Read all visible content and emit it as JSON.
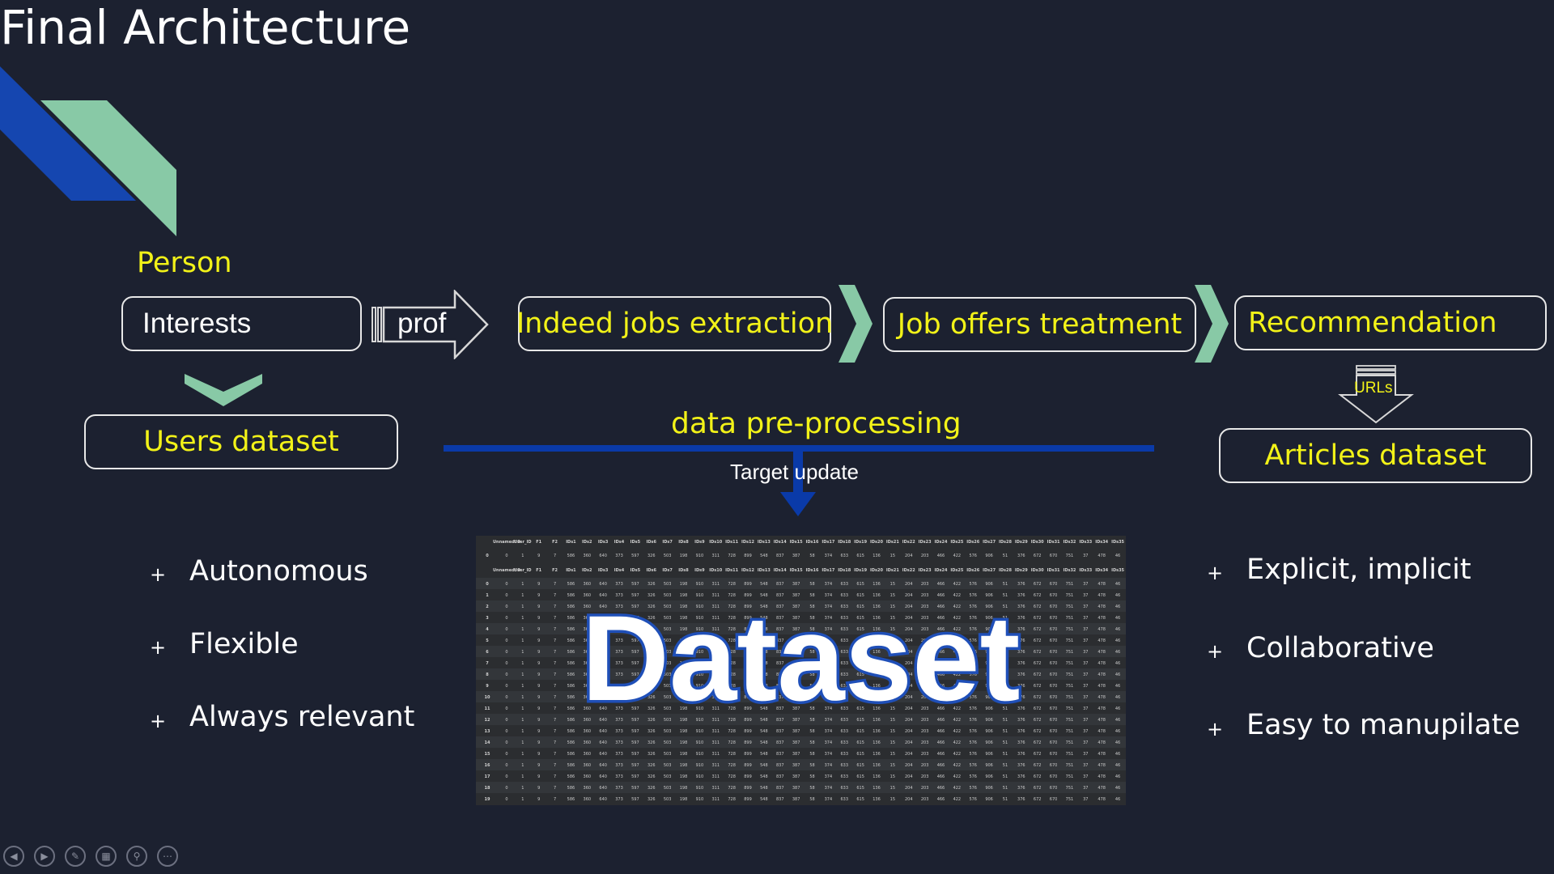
{
  "slide": {
    "title": "Final Architecture"
  },
  "flow": {
    "person_label": "Person",
    "interests": "Interests",
    "prof_arrow": "prof",
    "indeed": "Indeed jobs extraction",
    "treatment": "Job offers treatment",
    "recommendation": "Recommendation",
    "urls_arrow": "URLs",
    "users_dataset": "Users dataset",
    "preprocessing": "data pre-processing",
    "target_update": "Target update",
    "articles_dataset": "Articles dataset"
  },
  "dataset_image": {
    "overlay_word": "Dataset",
    "header_cols": [
      "Unnamed: 0",
      "User_ID",
      "F1",
      "F2",
      "IDs1",
      "IDs2",
      "IDs3",
      "IDs4",
      "IDs5",
      "IDs6",
      "IDs7",
      "IDs8",
      "IDs9",
      "IDs10",
      "IDs11",
      "IDs12",
      "IDs13",
      "IDs14",
      "IDs15",
      "IDs16",
      "IDs17",
      "IDs18",
      "IDs19",
      "IDs20",
      "IDs21",
      "IDs22",
      "IDs23",
      "IDs24",
      "IDs25",
      "IDs26",
      "IDs27",
      "IDs28",
      "IDs29",
      "IDs30",
      "IDs31",
      "IDs32",
      "IDs33",
      "IDs34",
      "IDs35"
    ],
    "row_values": [
      "0",
      "1",
      "9",
      "7",
      "586",
      "360",
      "640",
      "373",
      "597",
      "326",
      "503",
      "198",
      "910",
      "311",
      "728",
      "899",
      "548",
      "837",
      "387",
      "58",
      "374",
      "633",
      "615",
      "136",
      "15",
      "204",
      "203",
      "466",
      "422",
      "576",
      "906",
      "51",
      "376",
      "672",
      "670",
      "751",
      "37",
      "478",
      "46"
    ],
    "row_indices": [
      "0",
      "1",
      "2",
      "3",
      "4",
      "5",
      "6",
      "7",
      "8",
      "9",
      "10",
      "11",
      "12",
      "13",
      "14",
      "15",
      "16",
      "17",
      "18",
      "19"
    ]
  },
  "left_bullets": [
    "Autonomous",
    "Flexible",
    "Always relevant"
  ],
  "right_bullets": [
    "Explicit, implicit",
    "Collaborative",
    "Easy to manupilate"
  ],
  "bullet_glyph": "+",
  "colors": {
    "background": "#1c2130",
    "yellow_text": "#f2f218",
    "accent_green": "#88c9a6",
    "accent_blue": "#1546b0"
  },
  "nav_icons": [
    "prev-icon",
    "next-icon",
    "pen-icon",
    "slides-icon",
    "zoom-icon",
    "more-icon"
  ]
}
